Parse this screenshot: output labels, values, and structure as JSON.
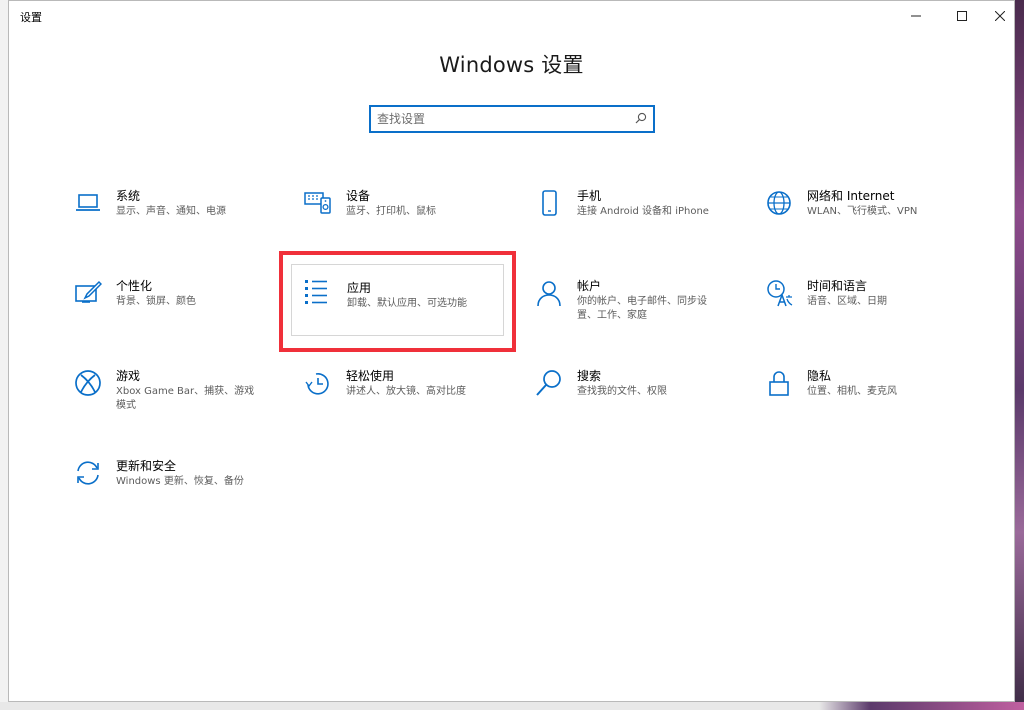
{
  "window": {
    "title": "设置"
  },
  "page": {
    "title": "Windows 设置"
  },
  "search": {
    "placeholder": "查找设置"
  },
  "accent_color": "#0a6fc9",
  "highlight_color": "#f0303a",
  "tiles": [
    {
      "title": "系统",
      "desc": "显示、声音、通知、电源",
      "icon": "laptop-icon"
    },
    {
      "title": "设备",
      "desc": "蓝牙、打印机、鼠标",
      "icon": "devices-icon"
    },
    {
      "title": "手机",
      "desc": "连接 Android 设备和 iPhone",
      "icon": "phone-icon"
    },
    {
      "title": "网络和 Internet",
      "desc": "WLAN、飞行模式、VPN",
      "icon": "globe-icon"
    },
    {
      "title": "个性化",
      "desc": "背景、锁屏、颜色",
      "icon": "personalization-icon"
    },
    {
      "title": "应用",
      "desc": "卸载、默认应用、可选功能",
      "icon": "apps-list-icon",
      "selected": true
    },
    {
      "title": "帐户",
      "desc": "你的帐户、电子邮件、同步设置、工作、家庭",
      "icon": "person-icon"
    },
    {
      "title": "时间和语言",
      "desc": "语音、区域、日期",
      "icon": "time-language-icon"
    },
    {
      "title": "游戏",
      "desc": "Xbox Game Bar、捕获、游戏模式",
      "icon": "xbox-icon"
    },
    {
      "title": "轻松使用",
      "desc": "讲述人、放大镜、高对比度",
      "icon": "ease-of-access-icon"
    },
    {
      "title": "搜索",
      "desc": "查找我的文件、权限",
      "icon": "search-magnifier-icon"
    },
    {
      "title": "隐私",
      "desc": "位置、相机、麦克风",
      "icon": "lock-icon"
    },
    {
      "title": "更新和安全",
      "desc": "Windows 更新、恢复、备份",
      "icon": "sync-icon"
    }
  ]
}
